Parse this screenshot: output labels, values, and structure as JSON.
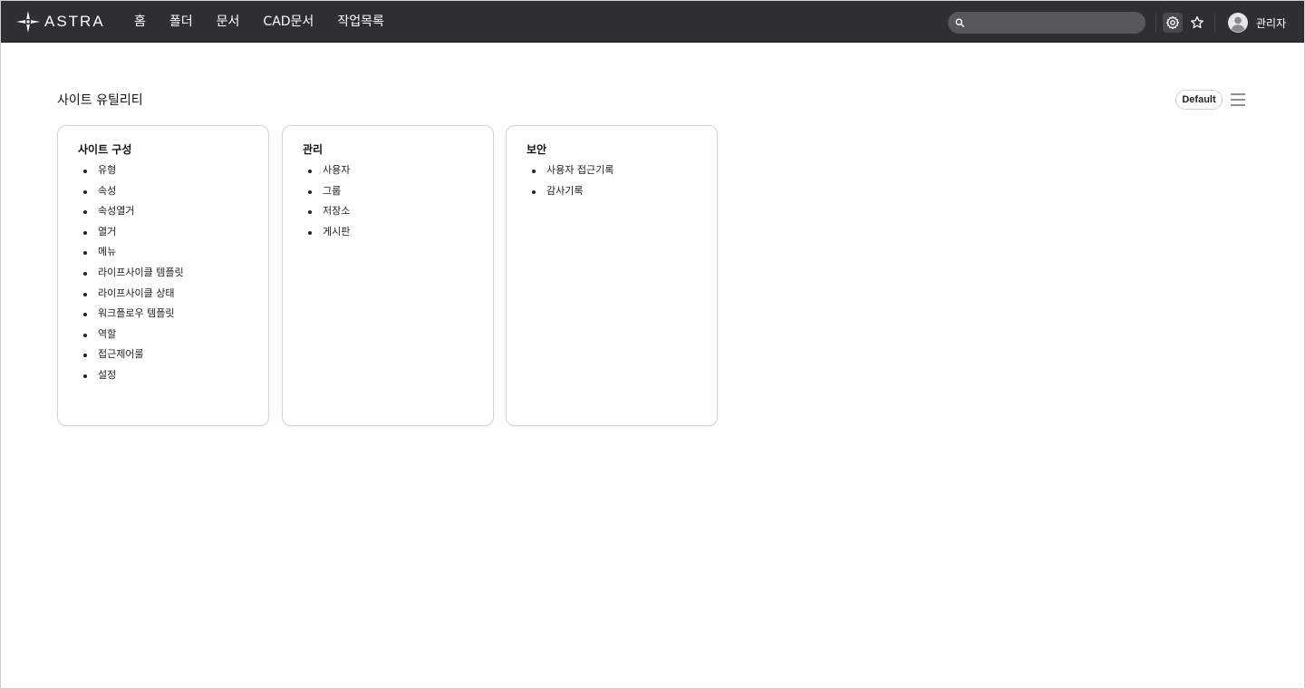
{
  "app": {
    "logo_text": "ASTRA"
  },
  "nav": {
    "items": [
      {
        "label": "홈"
      },
      {
        "label": "폴더"
      },
      {
        "label": "문서"
      },
      {
        "label": "CAD문서"
      },
      {
        "label": "작업목록"
      }
    ]
  },
  "search": {
    "placeholder": "",
    "icon": "search-icon"
  },
  "header_icons": {
    "settings": "gear-icon",
    "favorites": "star-icon",
    "avatar": "user-avatar-icon"
  },
  "user": {
    "name": "관리자"
  },
  "page": {
    "title": "사이트 유틸리티",
    "view_selector": "Default",
    "menu_icon": "hamburger-menu-icon"
  },
  "cards": [
    {
      "title": "사이트 구성",
      "items": [
        "유형",
        "속성",
        "속성열거",
        "열거",
        "메뉴",
        "라이프사이클 템플릿",
        "라이프사이클 상태",
        "워크플로우 템플릿",
        "역할",
        "접근제어룰",
        "설정"
      ]
    },
    {
      "title": "관리",
      "items": [
        "사용자",
        "그룹",
        "저장소",
        "게시판"
      ]
    },
    {
      "title": "보안",
      "items": [
        "사용자 접근기록",
        "감사기록"
      ]
    }
  ],
  "colors": {
    "topbar_bg": "#2f2f33",
    "search_bg": "#58585c",
    "page_bg": "#ffffff",
    "card_border": "#d4d4d4"
  }
}
